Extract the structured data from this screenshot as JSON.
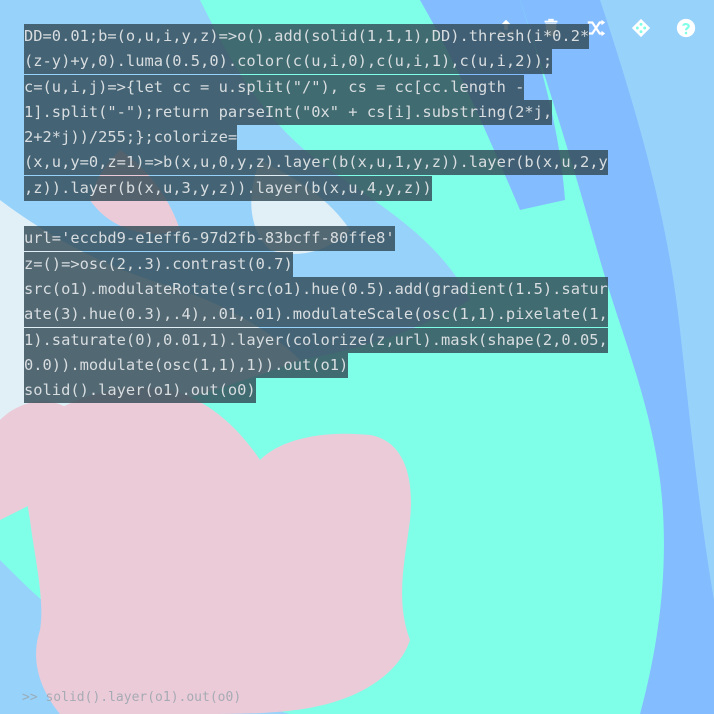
{
  "toolbar": {
    "buttons": [
      {
        "name": "share-button",
        "icon": "upload-icon"
      },
      {
        "name": "clear-button",
        "icon": "trash-icon"
      },
      {
        "name": "shuffle-button",
        "icon": "shuffle-icon"
      },
      {
        "name": "random-button",
        "icon": "dice-icon"
      },
      {
        "name": "help-button",
        "icon": "help-icon"
      }
    ]
  },
  "editor": {
    "lines": [
      "DD=0.01;b=(o,u,i,y,z)=>o().add(solid(1,1,1),DD).thresh(i*0.2*",
      "(z-y)+y,0).luma(0.5,0).color(c(u,i,0),c(u,i,1),c(u,i,2));",
      "c=(u,i,j)=>{let cc = u.split(\"/\"), cs = cc[cc.length -",
      "1].split(\"-\");return parseInt(\"0x\" + cs[i].substring(2*j,",
      "2+2*j))/255;};colorize=",
      "(x,u,y=0,z=1)=>b(x,u,0,y,z).layer(b(x,u,1,y,z)).layer(b(x,u,2,y",
      ",z)).layer(b(x,u,3,y,z)).layer(b(x,u,4,y,z))",
      "",
      "url='eccbd9-e1eff6-97d2fb-83bcff-80ffe8'",
      "z=()=>osc(2,.3).contrast(0.7)",
      "src(o1).modulateRotate(src(o1).hue(0.5).add(gradient(1.5).satur",
      "ate(3).hue(0.3),.4),.01,.01).modulateScale(osc(1,1).pixelate(1,",
      "1).saturate(0),0.01,1).layer(colorize(z,url).mask(shape(2,0.05,",
      "0.0)).modulate(osc(1,1),1)).out(o1)",
      "solid().layer(o1).out(o0)"
    ]
  },
  "console": {
    "text": ">> solid().layer(o1).out(o0)"
  },
  "colors": {
    "pink": "#eccbd9",
    "pale_blue": "#e1eff6",
    "sky_blue": "#97d2fb",
    "blue": "#83bcff",
    "aqua": "#80ffe8",
    "code_bg": "#324a56"
  }
}
